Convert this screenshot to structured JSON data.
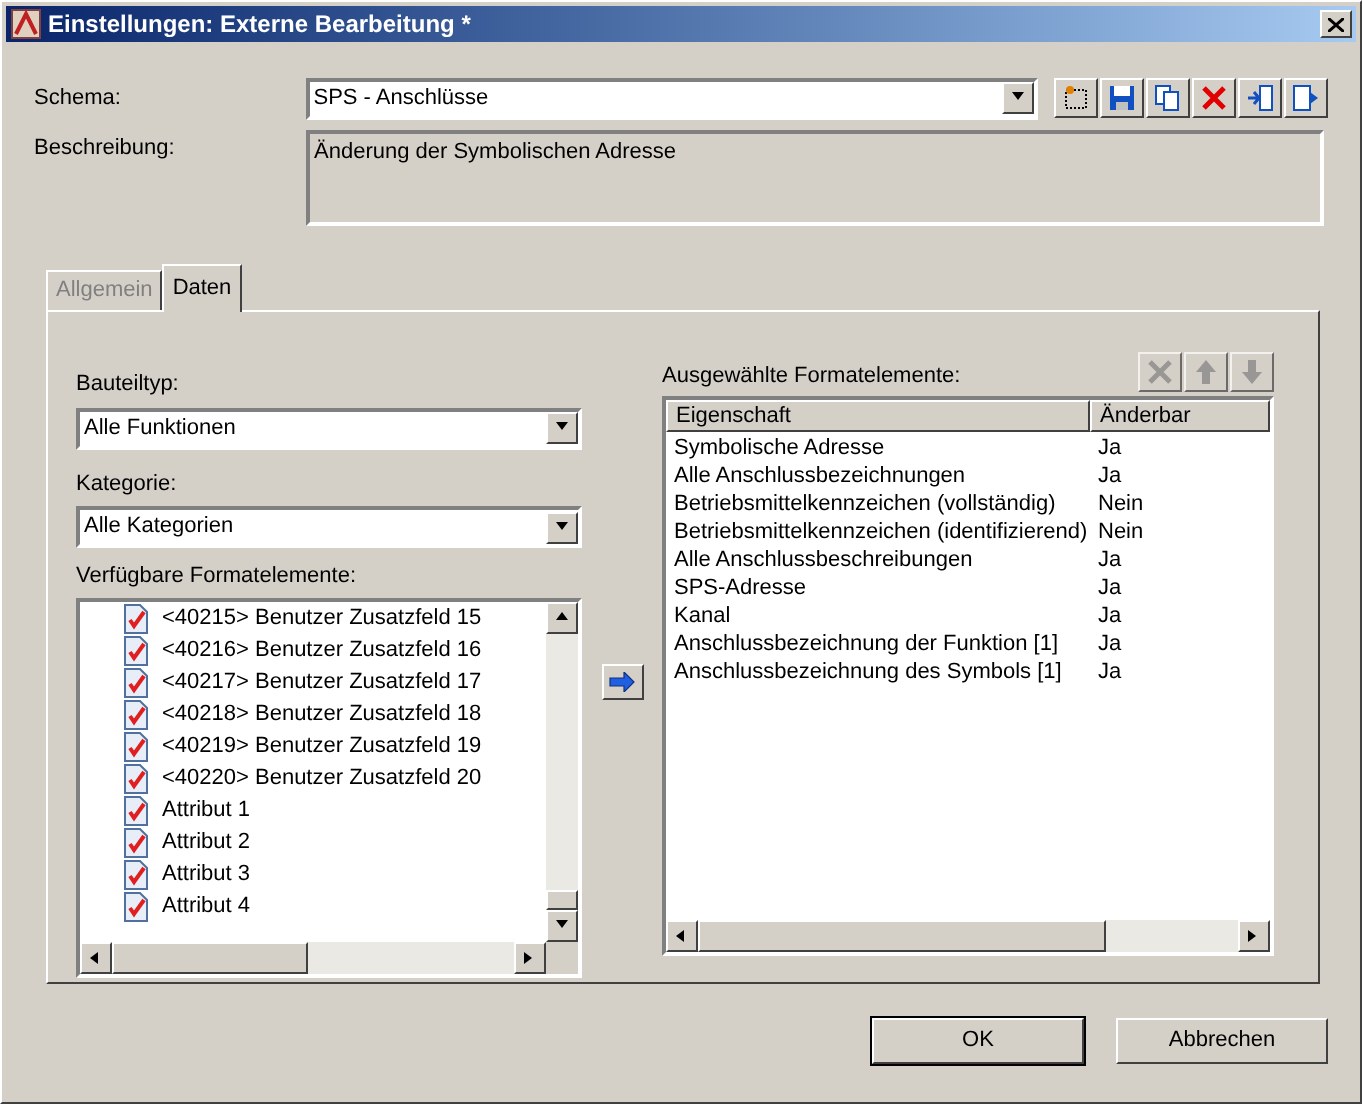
{
  "window": {
    "title": "Einstellungen: Externe Bearbeitung *"
  },
  "schema": {
    "label": "Schema:",
    "value": "SPS - Anschlüsse"
  },
  "schema_toolbar": [
    {
      "kind": "new"
    },
    {
      "kind": "save"
    },
    {
      "kind": "copy"
    },
    {
      "kind": "delete"
    },
    {
      "kind": "import"
    },
    {
      "kind": "export"
    }
  ],
  "description": {
    "label": "Beschreibung:",
    "value": "Änderung der Symbolischen Adresse"
  },
  "tabs": [
    {
      "label": "Allgemein",
      "selected": false
    },
    {
      "label": "Daten",
      "selected": true
    }
  ],
  "component_type": {
    "label": "Bauteiltyp:",
    "value": "Alle Funktionen"
  },
  "category": {
    "label": "Kategorie:",
    "value": "Alle Kategorien"
  },
  "available": {
    "label": "Verfügbare Formatelemente:",
    "items": [
      {
        "label": "<40215> Benutzer Zusatzfeld 15"
      },
      {
        "label": "<40216> Benutzer Zusatzfeld 16"
      },
      {
        "label": "<40217> Benutzer Zusatzfeld 17"
      },
      {
        "label": "<40218> Benutzer Zusatzfeld 18"
      },
      {
        "label": "<40219> Benutzer Zusatzfeld 19"
      },
      {
        "label": "<40220> Benutzer Zusatzfeld 20"
      },
      {
        "label": "Attribut 1"
      },
      {
        "label": "Attribut 2"
      },
      {
        "label": "Attribut 3"
      },
      {
        "label": "Attribut 4"
      }
    ]
  },
  "selected_elements": {
    "label": "Ausgewählte Formatelemente:",
    "toolbar": [
      {
        "kind": "delete",
        "disabled": true
      },
      {
        "kind": "up",
        "disabled": true
      },
      {
        "kind": "down",
        "disabled": true
      }
    ],
    "columns": [
      "Eigenschaft",
      "Änderbar"
    ],
    "rows": [
      {
        "property": "Symbolische Adresse",
        "editable": "Ja"
      },
      {
        "property": "Alle Anschlussbezeichnungen",
        "editable": "Ja"
      },
      {
        "property": "Betriebsmittelkennzeichen (vollständig)",
        "editable": "Nein"
      },
      {
        "property": "Betriebsmittelkennzeichen (identifizierend)",
        "editable": "Nein"
      },
      {
        "property": "Alle Anschlussbeschreibungen",
        "editable": "Ja"
      },
      {
        "property": "SPS-Adresse",
        "editable": "Ja"
      },
      {
        "property": "Kanal",
        "editable": "Ja"
      },
      {
        "property": "Anschlussbezeichnung der Funktion [1]",
        "editable": "Ja"
      },
      {
        "property": "Anschlussbezeichnung des Symbols [1]",
        "editable": "Ja"
      }
    ]
  },
  "buttons": [
    {
      "label": "OK",
      "default": true
    },
    {
      "label": "Abbrechen",
      "default": false
    }
  ]
}
